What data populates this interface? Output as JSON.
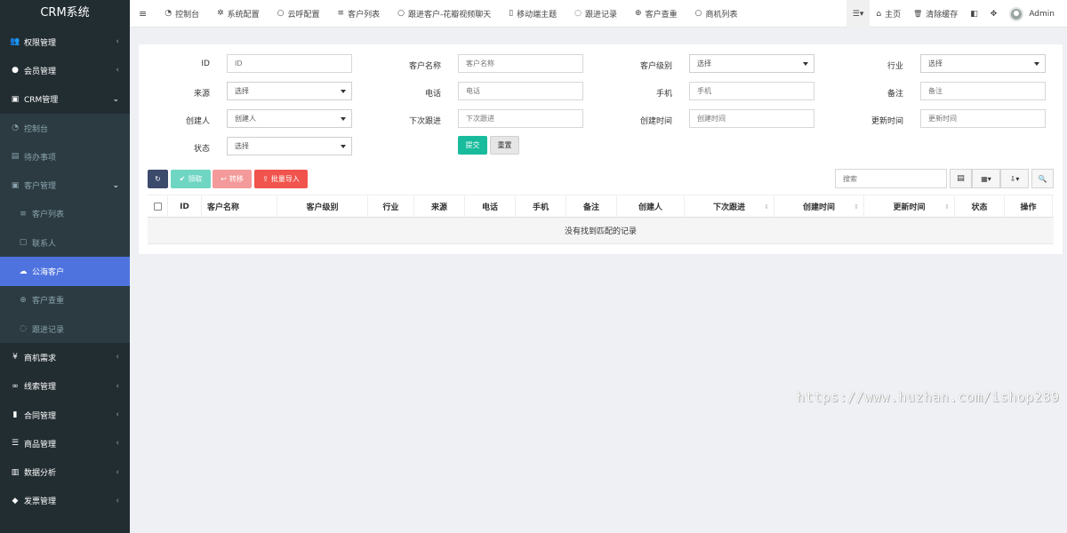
{
  "sidebar": {
    "logo": "CRM系统",
    "items": [
      {
        "label": "权限管理",
        "icon": "users-icon",
        "glyph": "👥",
        "chevron": "‹"
      },
      {
        "label": "会员管理",
        "icon": "user-circle-icon",
        "glyph": "●",
        "chevron": "‹"
      },
      {
        "label": "CRM管理",
        "icon": "id-card-icon",
        "glyph": "▣",
        "chevron": "⌄"
      },
      {
        "label": "控制台",
        "icon": "dashboard-icon",
        "glyph": "◔"
      },
      {
        "label": "待办事项",
        "icon": "calendar-icon",
        "glyph": "▤"
      },
      {
        "label": "客户管理",
        "icon": "id-card-icon",
        "glyph": "▣",
        "chevron": "⌄"
      },
      {
        "label": "客户列表",
        "icon": "list-icon",
        "glyph": "≡"
      },
      {
        "label": "联系人",
        "icon": "contact-icon",
        "glyph": "▢"
      },
      {
        "label": "公海客户",
        "icon": "cloud-icon",
        "glyph": "☁"
      },
      {
        "label": "客户查重",
        "icon": "search-plus-icon",
        "glyph": "⊕"
      },
      {
        "label": "跟进记录",
        "icon": "comments-icon",
        "glyph": "◌"
      },
      {
        "label": "商机需求",
        "icon": "yen-icon",
        "glyph": "¥",
        "chevron": "‹"
      },
      {
        "label": "线索管理",
        "icon": "link-icon",
        "glyph": "∞",
        "chevron": "‹"
      },
      {
        "label": "合同管理",
        "icon": "bookmark-icon",
        "glyph": "▮",
        "chevron": "‹"
      },
      {
        "label": "商品管理",
        "icon": "list-alt-icon",
        "glyph": "☰",
        "chevron": "‹"
      },
      {
        "label": "数据分析",
        "icon": "bar-chart-icon",
        "glyph": "▥",
        "chevron": "‹"
      },
      {
        "label": "发票管理",
        "icon": "ticket-icon",
        "glyph": "◆",
        "chevron": "‹"
      }
    ]
  },
  "topbar": {
    "menu_glyph": "≡",
    "items": [
      {
        "label": "控制台",
        "icon": "dashboard-icon",
        "glyph": "◔"
      },
      {
        "label": "系统配置",
        "icon": "gear-icon",
        "glyph": "✲"
      },
      {
        "label": "云呼配置",
        "icon": "circle-icon",
        "glyph": "○"
      },
      {
        "label": "客户列表",
        "icon": "list-icon",
        "glyph": "≡"
      },
      {
        "label": "跟进客户-花瓣视频聊天",
        "icon": "circle-icon",
        "glyph": "○"
      },
      {
        "label": "移动端主题",
        "icon": "mobile-icon",
        "glyph": "▯"
      },
      {
        "label": "跟进记录",
        "icon": "comments-icon",
        "glyph": "◌"
      },
      {
        "label": "客户查重",
        "icon": "search-plus-icon",
        "glyph": "⊕"
      },
      {
        "label": "商机列表",
        "icon": "circle-icon",
        "glyph": "○"
      }
    ],
    "right": {
      "menu_glyph": "☰▾",
      "home_label": "主页",
      "home_glyph": "⌂",
      "clear_cache_label": "清除缓存",
      "clear_cache_glyph": "🗑",
      "translate_glyph": "◧",
      "fullscreen_glyph": "✥",
      "user_name": "Admin"
    }
  },
  "search_form": {
    "fields": [
      {
        "label": "ID",
        "placeholder": "ID",
        "type": "input"
      },
      {
        "label": "客户名称",
        "placeholder": "客户名称",
        "type": "input"
      },
      {
        "label": "客户级别",
        "value": "选择",
        "type": "select"
      },
      {
        "label": "行业",
        "value": "选择",
        "type": "select"
      },
      {
        "label": "来源",
        "value": "选择",
        "type": "select"
      },
      {
        "label": "电话",
        "placeholder": "电话",
        "type": "input"
      },
      {
        "label": "手机",
        "placeholder": "手机",
        "type": "input"
      },
      {
        "label": "备注",
        "placeholder": "备注",
        "type": "input"
      },
      {
        "label": "创建人",
        "value": "创建人",
        "type": "select"
      },
      {
        "label": "下次跟进",
        "placeholder": "下次跟进",
        "type": "input"
      },
      {
        "label": "创建时间",
        "placeholder": "创建时间",
        "type": "input"
      },
      {
        "label": "更新时间",
        "placeholder": "更新时间",
        "type": "input"
      },
      {
        "label": "状态",
        "value": "选择",
        "type": "select"
      }
    ],
    "submit_label": "提交",
    "reset_label": "重置"
  },
  "toolbar": {
    "refresh_glyph": "↻",
    "claim_label": "领取",
    "claim_glyph": "✔",
    "transfer_label": "转移",
    "transfer_glyph": "↩",
    "import_label": "批量导入",
    "import_glyph": "⇪",
    "search_placeholder": "搜索",
    "toggle_glyph": "▤",
    "columns_glyph": "▦▾",
    "export_glyph": "⇩▾",
    "search_glyph": "🔍"
  },
  "table": {
    "columns": [
      "ID",
      "客户名称",
      "客户级别",
      "行业",
      "来源",
      "电话",
      "手机",
      "备注",
      "创建人",
      "下次跟进",
      "创建时间",
      "更新时间",
      "状态",
      "操作"
    ],
    "sort_glyph": "⇕",
    "empty_text": "没有找到匹配的记录"
  },
  "watermark": "https://www.huzhan.com/ishop289",
  "colors": {
    "sidebar_bg": "#222d32",
    "active_item": "#4e73df",
    "refresh_btn": "#3c4a6b",
    "claim_btn": "#6fd6c3",
    "transfer_btn": "#f49a9a",
    "import_btn": "#f0544c",
    "submit_btn": "#18bc9c"
  }
}
